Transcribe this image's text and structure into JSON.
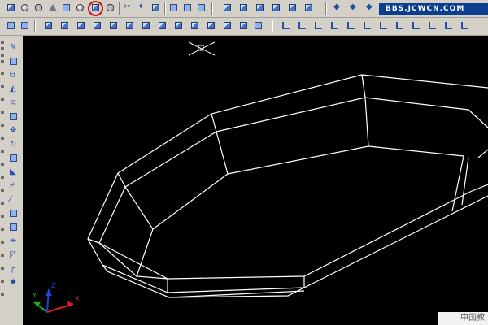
{
  "app": {
    "watermark_text": "BBS.JCWCN.COM",
    "corner_logo_text": "中国教"
  },
  "colors": {
    "toolbar_bg": "#d4d0c8",
    "viewport_bg": "#000000",
    "wireframe": "#ffffff",
    "highlight": "#d01010",
    "watermark_bg": "#0a3f8f"
  },
  "toolbars": {
    "solids_toolbar": [
      "box",
      "sphere",
      "cylinder",
      "cone",
      "wedge",
      "torus",
      "extrude-highlighted",
      "revolve"
    ],
    "solid_editing": [
      "slice",
      "section",
      "interference",
      "union",
      "subtract",
      "intersect"
    ],
    "views": [
      "top-view",
      "bottom-view",
      "left-view",
      "right-view",
      "front-view",
      "back-view",
      "sw-iso",
      "se-iso",
      "ne-iso",
      "nw-iso"
    ],
    "ucs": [
      "ucs",
      "world-ucs",
      "object-ucs",
      "face-ucs",
      "view-ucs",
      "origin-ucs",
      "z-axis-ucs",
      "3point-ucs",
      "x-ucs",
      "y-ucs",
      "z-ucs",
      "apply-ucs"
    ],
    "row2_tools": [
      "extrude-faces",
      "move-faces",
      "offset-faces",
      "delete-faces",
      "rotate-faces",
      "taper-faces",
      "copy-faces",
      "color-faces",
      "copy-edges",
      "color-edges",
      "imprint",
      "clean",
      "separate",
      "shell",
      "check"
    ]
  },
  "modify_toolbar": [
    "line",
    "erase",
    "copy",
    "mirror",
    "offset",
    "array",
    "move",
    "rotate",
    "scale",
    "stretch",
    "trim",
    "extend",
    "break-at-point",
    "break",
    "join",
    "chamfer",
    "fillet",
    "explode"
  ],
  "ucs_icon": {
    "x_label": "X",
    "y_label": "Y",
    "z_label": "Z"
  }
}
